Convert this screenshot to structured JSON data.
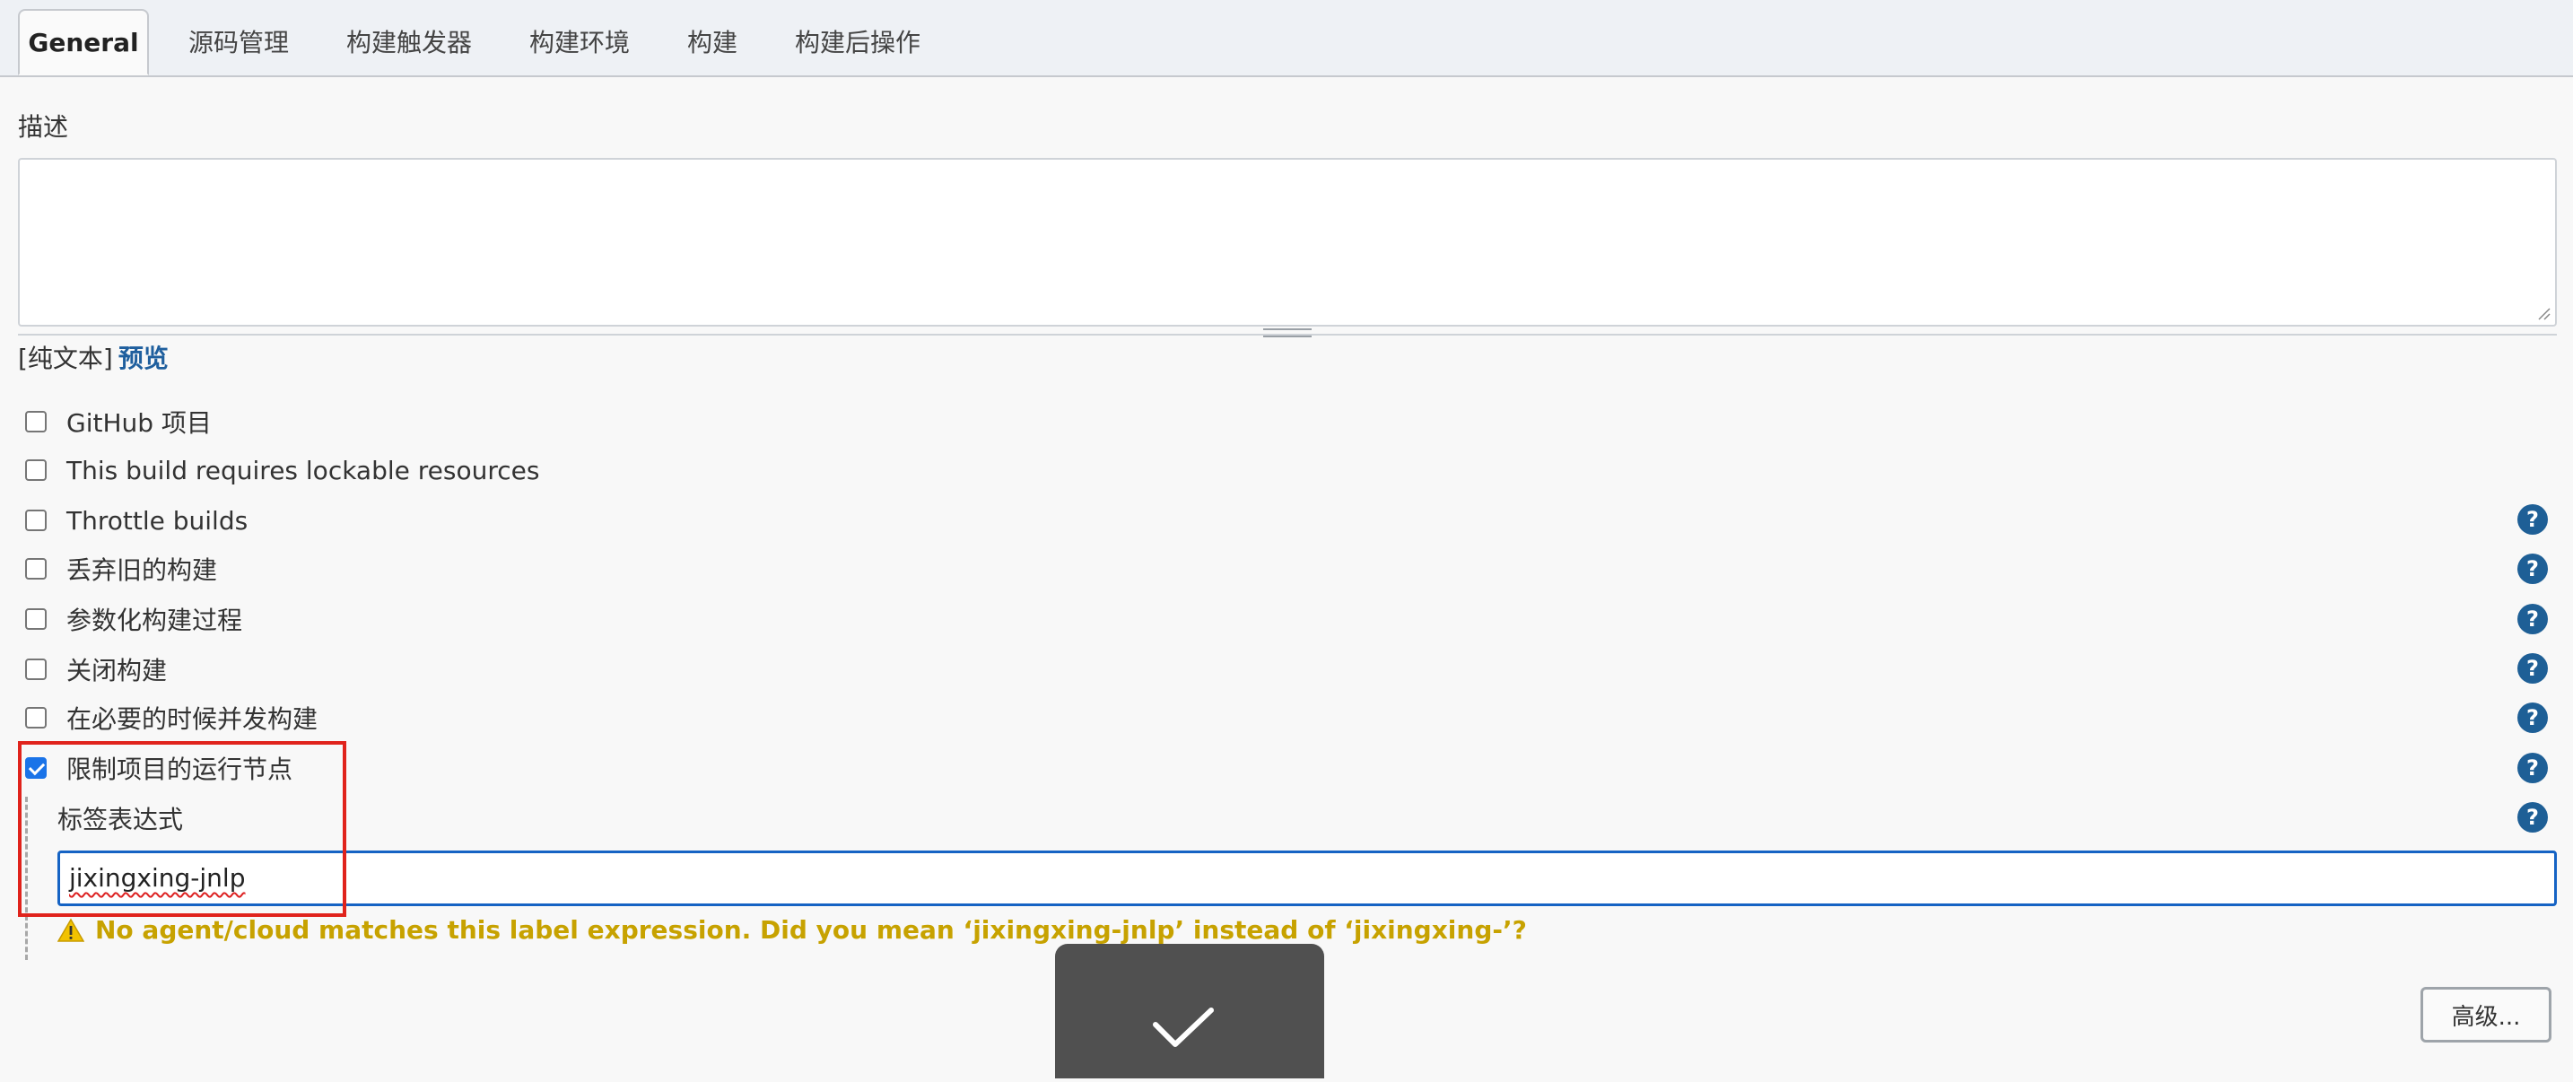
{
  "tabs": [
    {
      "label": "General",
      "active": true
    },
    {
      "label": "源码管理"
    },
    {
      "label": "构建触发器"
    },
    {
      "label": "构建环境"
    },
    {
      "label": "构建"
    },
    {
      "label": "构建后操作"
    }
  ],
  "description": {
    "label": "描述",
    "value": "",
    "format_prefix": "[纯文本]",
    "preview_link": "预览"
  },
  "options": [
    {
      "label": "GitHub 项目",
      "checked": false,
      "help": false
    },
    {
      "label": "This build requires lockable resources",
      "checked": false,
      "help": false
    },
    {
      "label": "Throttle builds",
      "checked": false,
      "help": true
    },
    {
      "label": "丢弃旧的构建",
      "checked": false,
      "help": true
    },
    {
      "label": "参数化构建过程",
      "checked": false,
      "help": true
    },
    {
      "label": "关闭构建",
      "checked": false,
      "help": true
    },
    {
      "label": "在必要的时候并发构建",
      "checked": false,
      "help": true
    },
    {
      "label": "限制项目的运行节点",
      "checked": true,
      "help": true
    }
  ],
  "restrict_node": {
    "sub_label": "标签表达式",
    "input_value": "jixingxing-jnlp",
    "warning": "No agent/cloud matches this label expression. Did you mean ‘jixingxing-jnlp’ instead of ‘jixingxing-’?"
  },
  "help_glyph": "?",
  "advanced_button": "高级...",
  "colors": {
    "accent_blue": "#1563c4",
    "help_blue": "#1e5f96",
    "warning": "#c7a200",
    "highlight_box": "#e0231c",
    "toast_bg": "#505050"
  },
  "icons": [
    "question-help-icon",
    "warning-triangle-icon",
    "checkmark-icon",
    "resize-grip-icon"
  ]
}
